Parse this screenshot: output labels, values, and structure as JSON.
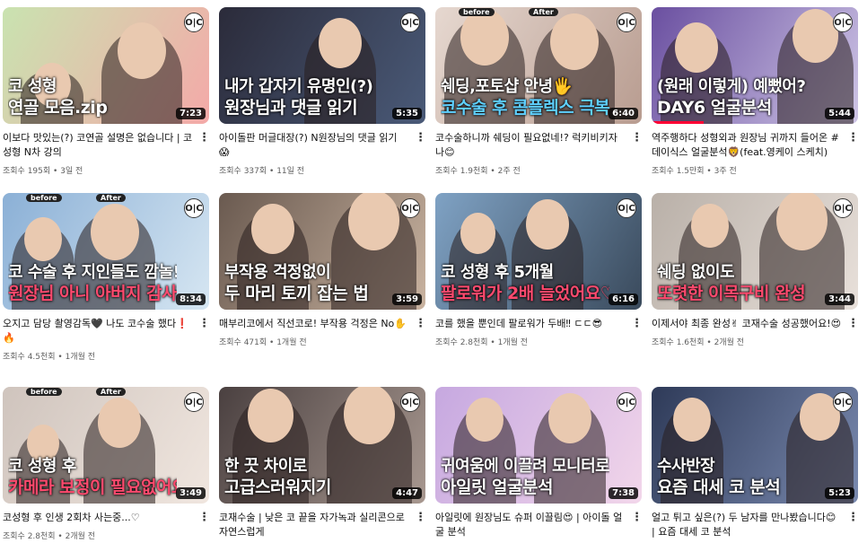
{
  "thumb_logo": "O|C",
  "before_label": "before",
  "after_label": "After",
  "videos": [
    {
      "title": "이보다 맛있는(?) 코연골 설명은 없습니다 | 코성형 N차 강의",
      "views": "조회수 195회",
      "age": "3일 전",
      "duration": "7:23",
      "caption1": "코 성형",
      "caption2": "연골 모음.zip",
      "progress": 0.0,
      "colors": [
        "#c9e3b0",
        "#f4a9a8"
      ]
    },
    {
      "title": "아이돌판 머글대장(?) N원장님의 댓글 읽기 😱",
      "views": "조회수 337회",
      "age": "11일 전",
      "duration": "5:35",
      "caption1": "내가 갑자기 유명인(?)",
      "caption2": "원장님과 댓글 읽기",
      "progress": 0.0,
      "colors": [
        "#2b2b3a",
        "#4a5a78"
      ]
    },
    {
      "title": "코수술하니까 쉐딩이 필요없네!? 럭키비키자나😊",
      "views": "조회수 1.9천회",
      "age": "2주 전",
      "duration": "6:40",
      "caption1": "쉐딩,포토샵 안녕🖐",
      "caption2": "코수술 후 콤플렉스 극복",
      "progress": 0.0,
      "colors": [
        "#e6d8d0",
        "#b89c90"
      ]
    },
    {
      "title": "역주행하다 성형외과 원장님 귀까지 들어온 #데이식스 얼굴분석🦁(feat.영케이 스케치)",
      "views": "조회수 1.5만회",
      "age": "3주 전",
      "duration": "5:44",
      "caption1": "(원래 이렇게) 예뻤어?",
      "caption2": "DAY6 얼굴분석",
      "progress": 0.25,
      "colors": [
        "#6a4fa0",
        "#cfc6e6"
      ]
    },
    {
      "title": "오지고 담당 촬영감독🖤 나도 코수술 했다❗🔥",
      "views": "조회수 4.5천회",
      "age": "1개월 전",
      "duration": "8:34",
      "caption1": "코 수술 후 지인들도 깜놀!",
      "caption2": "원장님 아니 아버지 감사합니다",
      "progress": 0.0,
      "colors": [
        "#8bb0d6",
        "#d6e6f2"
      ]
    },
    {
      "title": "매부리코에서 직선코로! 부작용 걱정은 No✋",
      "views": "조회수 471회",
      "age": "1개월 전",
      "duration": "3:59",
      "caption1": "부작용 걱정없이",
      "caption2": "두 마리 토끼 잡는 법",
      "progress": 0.0,
      "colors": [
        "#6a5a50",
        "#c9b3a0"
      ]
    },
    {
      "title": "코를 했을 뿐인데 팔로워가 두배‼ ㄷㄷ😎",
      "views": "조회수 2.8천회",
      "age": "1개월 전",
      "duration": "6:16",
      "caption1": "코 성형 후 5개월",
      "caption2": "팔로워가 2배 늘었어요♡",
      "progress": 0.0,
      "colors": [
        "#7fa2c4",
        "#3a4a5c"
      ]
    },
    {
      "title": "이제서야 최종 완성✌ 코재수술 성공했어요!😍",
      "views": "조회수 1.6천회",
      "age": "2개월 전",
      "duration": "3:44",
      "caption1": "쉐딩 없이도",
      "caption2": "또렷한 이목구비 완성",
      "progress": 0.0,
      "colors": [
        "#b9b0a8",
        "#e8e0da"
      ]
    },
    {
      "title": "코성형 후 인생 2회차 사는중...♡",
      "views": "조회수 2.8천회",
      "age": "2개월 전",
      "duration": "3:49",
      "caption1": "코 성형 후",
      "caption2": "카메라 보정이 필요없어요",
      "progress": 0.0,
      "colors": [
        "#cfc4bd",
        "#f0e6df"
      ]
    },
    {
      "title": "코재수술 | 낮은 코 끝을 자가녹과 실리콘으로 자연스럽게",
      "views": "",
      "age": "",
      "duration": "4:47",
      "caption1": "한 끗 차이로",
      "caption2": "고급스러워지기",
      "progress": 0.0,
      "colors": [
        "#4a4040",
        "#a89890"
      ]
    },
    {
      "title": "아일릿에 원장님도 슈퍼 이끌림😍 | 아이돌 얼굴 분석",
      "views": "",
      "age": "",
      "duration": "7:38",
      "caption1": "귀여움에 이끌려 모니터로...",
      "caption2": "아일릿 얼굴분석",
      "progress": 0.0,
      "colors": [
        "#c6a8e0",
        "#f2d6ea"
      ]
    },
    {
      "title": "얼고 튀고 싶은(?) 두 남자를 만나봤습니다😊 | 요즘 대세 코 분석",
      "views": "",
      "age": "",
      "duration": "5:23",
      "caption1": "수사반장",
      "caption2": "요즘 대세 코 분석",
      "progress": 0.0,
      "colors": [
        "#2e3a58",
        "#7a8ab0"
      ]
    }
  ],
  "more_icon": "more-vert-icon"
}
